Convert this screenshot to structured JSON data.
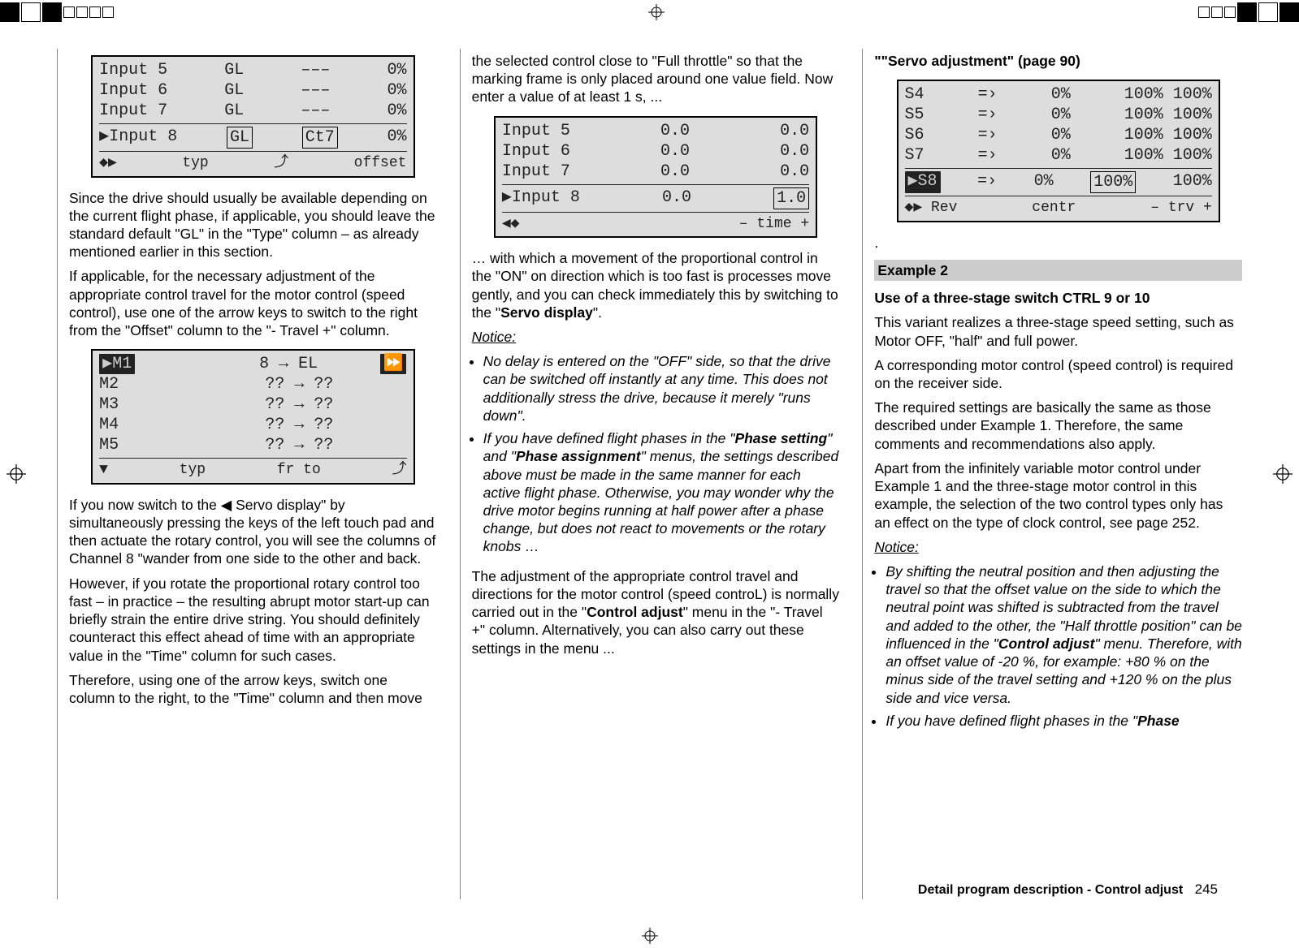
{
  "col1": {
    "lcd1": {
      "rows": [
        [
          "Input 5",
          "GL",
          "–––",
          "0%"
        ],
        [
          "Input 6",
          "GL",
          "–––",
          "0%"
        ],
        [
          "Input 7",
          "GL",
          "–––",
          "0%"
        ]
      ],
      "selrow": [
        "▶Input 8",
        "GL",
        "Ct7",
        "0%"
      ],
      "footer": [
        "◆▶",
        "typ",
        "⤴",
        "offset"
      ]
    },
    "p1": "Since the drive should usually be available depending on the current flight phase, if applicable, you should leave the standard default \"GL\" in the \"Type\" column – as already mentioned earlier in this section.",
    "p2": "If applicable, for the necessary adjustment of the appropriate control travel for the motor control (speed control), use one of the arrow keys to switch to the right from the \"Offset\" column to the \"- Travel +\" column.",
    "lcd2": {
      "row1": [
        "▶M1",
        "",
        "8 → EL",
        "⏩"
      ],
      "rows": [
        [
          "M2",
          "",
          "?? → ??",
          ""
        ],
        [
          "M3",
          "",
          "?? → ??",
          ""
        ],
        [
          "M4",
          "",
          "?? → ??",
          ""
        ],
        [
          "M5",
          "",
          "?? → ??",
          ""
        ]
      ],
      "footer": [
        "▼",
        "typ",
        "fr   to",
        "⤴"
      ]
    },
    "p3": "If you now switch to the ◀ Servo display\" by simultaneously pressing the keys of the left touch pad and then actuate the rotary control, you will see the columns of Channel 8 \"wander from one side to the other and back.",
    "p4": "However, if you rotate the proportional rotary control too fast – in practice – the resulting abrupt motor start-up can briefly strain the entire drive string. You should definitely counteract this effect ahead of time with an appropriate value in the \"Time\" column for such cases.",
    "p5": "Therefore, using one of the arrow keys, switch one column to the right, to the \"Time\" column and then move"
  },
  "col2": {
    "p1": "the selected control close to \"Full throttle\" so that the marking frame is only placed around one value field. Now enter a value of at least 1 s, ...",
    "lcd": {
      "rows": [
        [
          "Input 5",
          "0.0",
          "0.0"
        ],
        [
          "Input 6",
          "0.0",
          "0.0"
        ],
        [
          "Input 7",
          "0.0",
          "0.0"
        ]
      ],
      "selrow": [
        "▶Input 8",
        "0.0",
        "1.0"
      ],
      "footer": [
        "◀◆",
        "",
        "– time +"
      ]
    },
    "p2": "… with which a movement of the proportional control in the \"ON\" on direction which is too fast is processes move gently, and you can check immediately this by switching to the \"",
    "p2b": "Servo display",
    "p2c": "\".",
    "noticeLabel": "Notice:",
    "li1": "No delay is entered on the \"OFF\" side, so that the drive can be switched off instantly at any time. This does not additionally stress the drive, because it merely \"runs down\".",
    "li2a": "If you have defined flight phases in the \"",
    "li2b": "Phase setting",
    "li2c": "\" and \"",
    "li2d": "Phase assignment",
    "li2e": "\" menus, the settings described above must be made in the same manner for each active flight phase. Otherwise, you may wonder why the drive motor begins running at half power after a phase change, but does not react to movements or the rotary knobs …",
    "p3a": "The adjustment of the appropriate control travel and directions for the motor control (speed controL) is normally carried out in the \"",
    "p3b": "Control adjust",
    "p3c": "\" menu in the \"- Travel +\" column. Alternatively, you can also carry out these settings in the menu ..."
  },
  "col3": {
    "title": "\"\"Servo adjustment\" (page 90)",
    "lcd": {
      "rows": [
        [
          "S4",
          "=›",
          "0%",
          "100% 100%"
        ],
        [
          "S5",
          "=›",
          "0%",
          "100% 100%"
        ],
        [
          "S6",
          "=›",
          "0%",
          "100% 100%"
        ],
        [
          "S7",
          "=›",
          "0%",
          "100% 100%"
        ]
      ],
      "selrow": [
        "▶S8",
        "=›",
        "0%",
        "100%",
        "100%"
      ],
      "footer": [
        "◆▶ Rev",
        "centr",
        "–  trv  +"
      ]
    },
    "dot": ".",
    "exampleLabel": "Example 2",
    "sub": "Use of a three-stage switch CTRL 9 or 10",
    "p1": "This variant realizes a three-stage speed setting, such as  Motor OFF, \"half\" and full power.",
    "p2": "A corresponding motor control (speed control) is required on the receiver side.",
    "p3": "The required settings are basically the same as those described under Example 1. Therefore, the same comments and recommendations also apply.",
    "p4": "Apart from the infinitely variable motor control under Example 1 and the three-stage motor control in this example, the selection of the two control types only has an effect on the type of clock control, see page 252.",
    "noticeLabel": "Notice:",
    "li1a": "By shifting the neutral position and then adjusting the travel so that the offset value on the side to which the neutral point was shifted is subtracted from the travel and added to the other, the \"Half throttle position\" can be influenced in the \"",
    "li1b": "Control adjust",
    "li1c": "\" menu. Therefore, with an offset value of -20 %, for  example: +80 % on the minus side of the travel setting and +120 % on the plus side and vice versa.",
    "li2a": "If you have defined flight phases in the \"",
    "li2b": "Phase"
  },
  "footer": {
    "text": "Detail program description - Control adjust",
    "page": "245"
  }
}
